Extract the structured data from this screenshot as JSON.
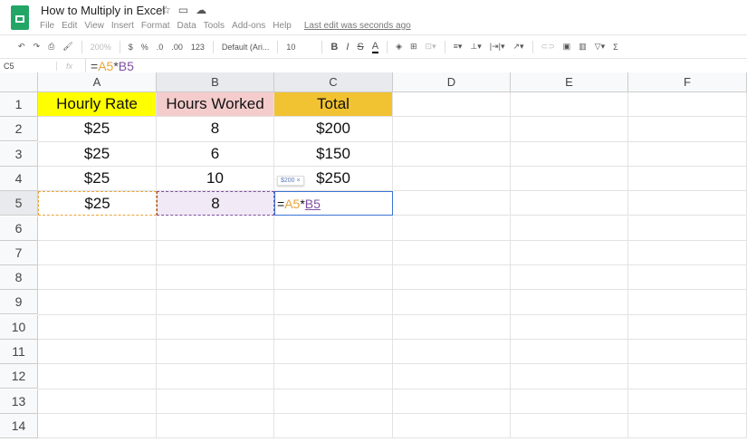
{
  "doc": {
    "title": "How to Multiply in Excel",
    "last_edit": "Last edit was seconds ago"
  },
  "menu": [
    "File",
    "Edit",
    "View",
    "Insert",
    "Format",
    "Data",
    "Tools",
    "Add-ons",
    "Help"
  ],
  "toolbar": {
    "zoom": "200%",
    "currency": "$",
    "percent": "%",
    "dec_less": ".0",
    "dec_more": ".00",
    "format": "123",
    "font": "Default (Ari...",
    "size": "10",
    "bold": "B",
    "italic": "I",
    "strike": "S",
    "textcolor": "A",
    "sum": "Σ"
  },
  "formula_bar": {
    "cell_ref": "C5",
    "fx": "fx",
    "eq": "=",
    "ref_a": "A5",
    "op": "*",
    "ref_b": "B5"
  },
  "columns": [
    "A",
    "B",
    "C",
    "D",
    "E",
    "F"
  ],
  "rows": [
    "1",
    "2",
    "3",
    "4",
    "5",
    "6",
    "7",
    "8",
    "9",
    "10",
    "11",
    "12",
    "13",
    "14"
  ],
  "cells": [
    [
      "Hourly Rate",
      "Hours Worked",
      "Total"
    ],
    [
      "$25",
      "8",
      "$200"
    ],
    [
      "$25",
      "6",
      "$150"
    ],
    [
      "$25",
      "10",
      "$250"
    ],
    [
      "$25",
      "8",
      ""
    ]
  ],
  "tooltip": "$200 ×",
  "colors": {
    "header_a": "#ffff00",
    "header_b": "#f4cccc",
    "header_c": "#f1c232",
    "ref_a": "#e8a43a",
    "ref_b": "#7e4fa0"
  }
}
